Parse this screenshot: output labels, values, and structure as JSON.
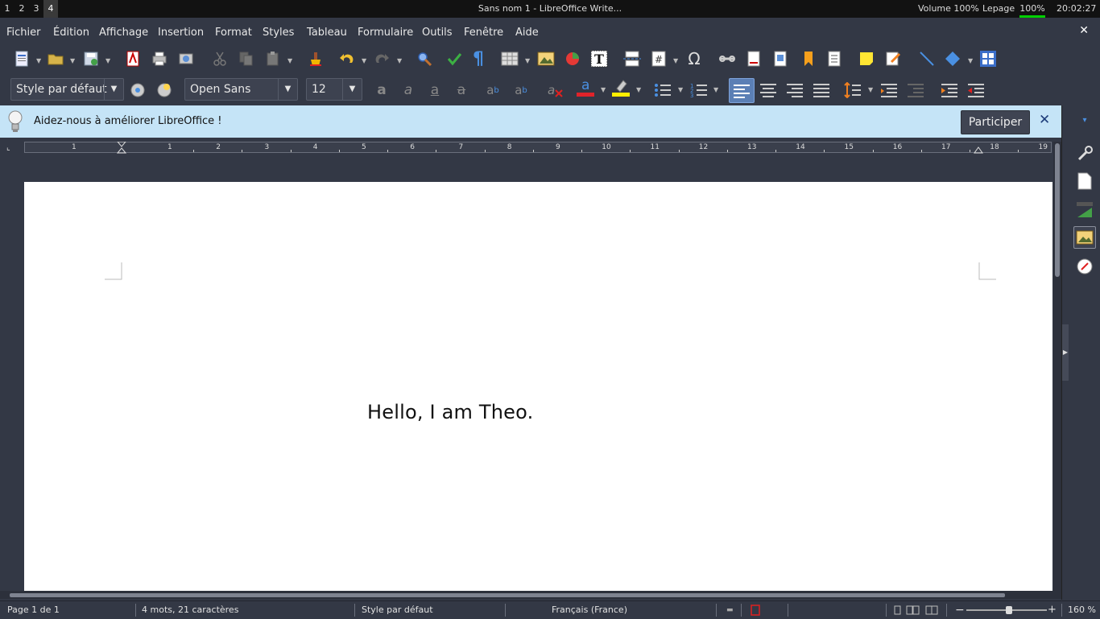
{
  "topbar": {
    "workspaces": [
      "1",
      "2",
      "3",
      "4"
    ],
    "window_title": "Sans nom 1 - LibreOffice Write...",
    "volume": "Volume 100%",
    "lepage": "Lepage",
    "battery": "100%",
    "clock": "20:02:27"
  },
  "menu": {
    "items": [
      "Fichier",
      "Édition",
      "Affichage",
      "Insertion",
      "Format",
      "Styles",
      "Tableau",
      "Formulaire",
      "Outils",
      "Fenêtre",
      "Aide"
    ],
    "close": "✕"
  },
  "toolbar2": {
    "paragraph_style": "Style par défaut",
    "font_name": "Open Sans",
    "font_size": "12"
  },
  "infobar": {
    "message": "Aidez-nous à améliorer LibreOffice !",
    "button": "Participer",
    "close": "✕"
  },
  "ruler": {
    "left_numbers": [
      "1"
    ],
    "numbers": [
      "1",
      "2",
      "3",
      "4",
      "5",
      "6",
      "7",
      "8",
      "9",
      "10",
      "11",
      "12",
      "13",
      "14",
      "15",
      "16",
      "17",
      "18",
      "19"
    ]
  },
  "document": {
    "text": "Hello, I am Theo."
  },
  "statusbar": {
    "page": "Page 1 de 1",
    "words": "4 mots, 21 caractères",
    "style": "Style par défaut",
    "language": "Français (France)",
    "zoom": "160 %"
  },
  "colors": {
    "font_color_bar": "#e0232a",
    "highlight_bar": "#ffee00",
    "battery_bar": "#00d000"
  }
}
